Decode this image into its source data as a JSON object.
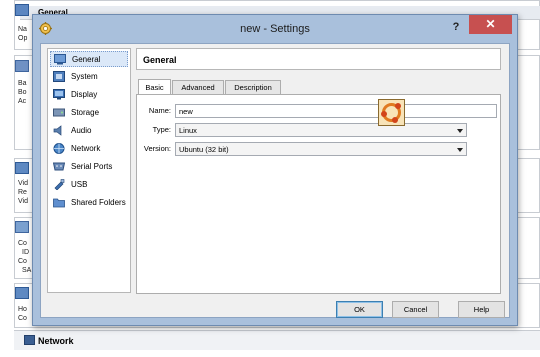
{
  "background": {
    "sections": [
      {
        "title": "General",
        "lines": [
          "Na",
          "Op"
        ]
      },
      {
        "title": "",
        "lines": [
          "Ba",
          "Bo",
          "Ac"
        ]
      },
      {
        "title": "",
        "lines": [
          "Vid",
          "Re",
          "Vid"
        ]
      },
      {
        "title": "",
        "lines": [
          "Co",
          "ID",
          "Co",
          "SA"
        ]
      },
      {
        "title": "",
        "lines": [
          "Ho",
          "Co"
        ]
      }
    ],
    "network_label": "Network"
  },
  "window": {
    "title": "new - Settings",
    "help_label": "?",
    "close_label": "✕"
  },
  "sidebar": {
    "items": [
      {
        "label": "General",
        "icon": "general-icon"
      },
      {
        "label": "System",
        "icon": "system-icon"
      },
      {
        "label": "Display",
        "icon": "display-icon"
      },
      {
        "label": "Storage",
        "icon": "storage-icon"
      },
      {
        "label": "Audio",
        "icon": "audio-icon"
      },
      {
        "label": "Network",
        "icon": "network-icon"
      },
      {
        "label": "Serial Ports",
        "icon": "serial-ports-icon"
      },
      {
        "label": "USB",
        "icon": "usb-icon"
      },
      {
        "label": "Shared Folders",
        "icon": "shared-folders-icon"
      }
    ],
    "selected": "General"
  },
  "page": {
    "header": "General",
    "tabs": [
      "Basic",
      "Advanced",
      "Description"
    ],
    "active_tab": "Basic",
    "fields": {
      "name_label": "Name:",
      "name_value": "new",
      "type_label": "Type:",
      "type_value": "Linux",
      "version_label": "Version:",
      "version_value": "Ubuntu (32 bit)"
    }
  },
  "buttons": {
    "ok": "OK",
    "cancel": "Cancel",
    "help": "Help"
  },
  "colors": {
    "window_frame": "#a9c0dc",
    "close_button": "#c75050",
    "selection": "#dbe8f8"
  }
}
